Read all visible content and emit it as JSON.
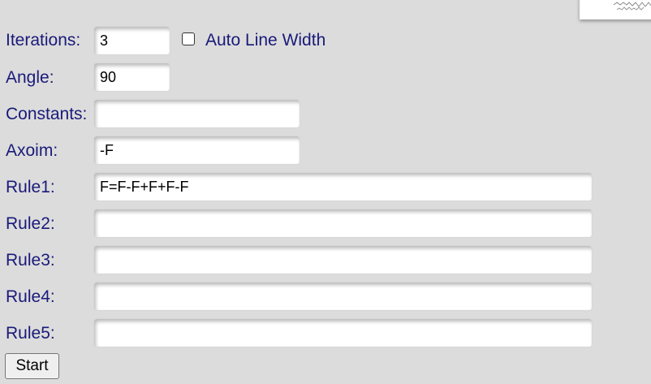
{
  "form": {
    "iterations": {
      "label": "Iterations:",
      "value": "3"
    },
    "auto_line_width": {
      "label": "Auto Line Width",
      "checked": false
    },
    "angle": {
      "label": "Angle:",
      "value": "90"
    },
    "constants": {
      "label": "Constants:",
      "value": ""
    },
    "axiom": {
      "label": "Axoim:",
      "value": "-F"
    },
    "rules": [
      {
        "label": "Rule1:",
        "value": "F=F-F+F+F-F"
      },
      {
        "label": "Rule2:",
        "value": ""
      },
      {
        "label": "Rule3:",
        "value": ""
      },
      {
        "label": "Rule4:",
        "value": ""
      },
      {
        "label": "Rule5:",
        "value": ""
      }
    ],
    "start_label": "Start"
  },
  "colors": {
    "label": "#1a1a7a",
    "background": "#dcdcdc"
  }
}
